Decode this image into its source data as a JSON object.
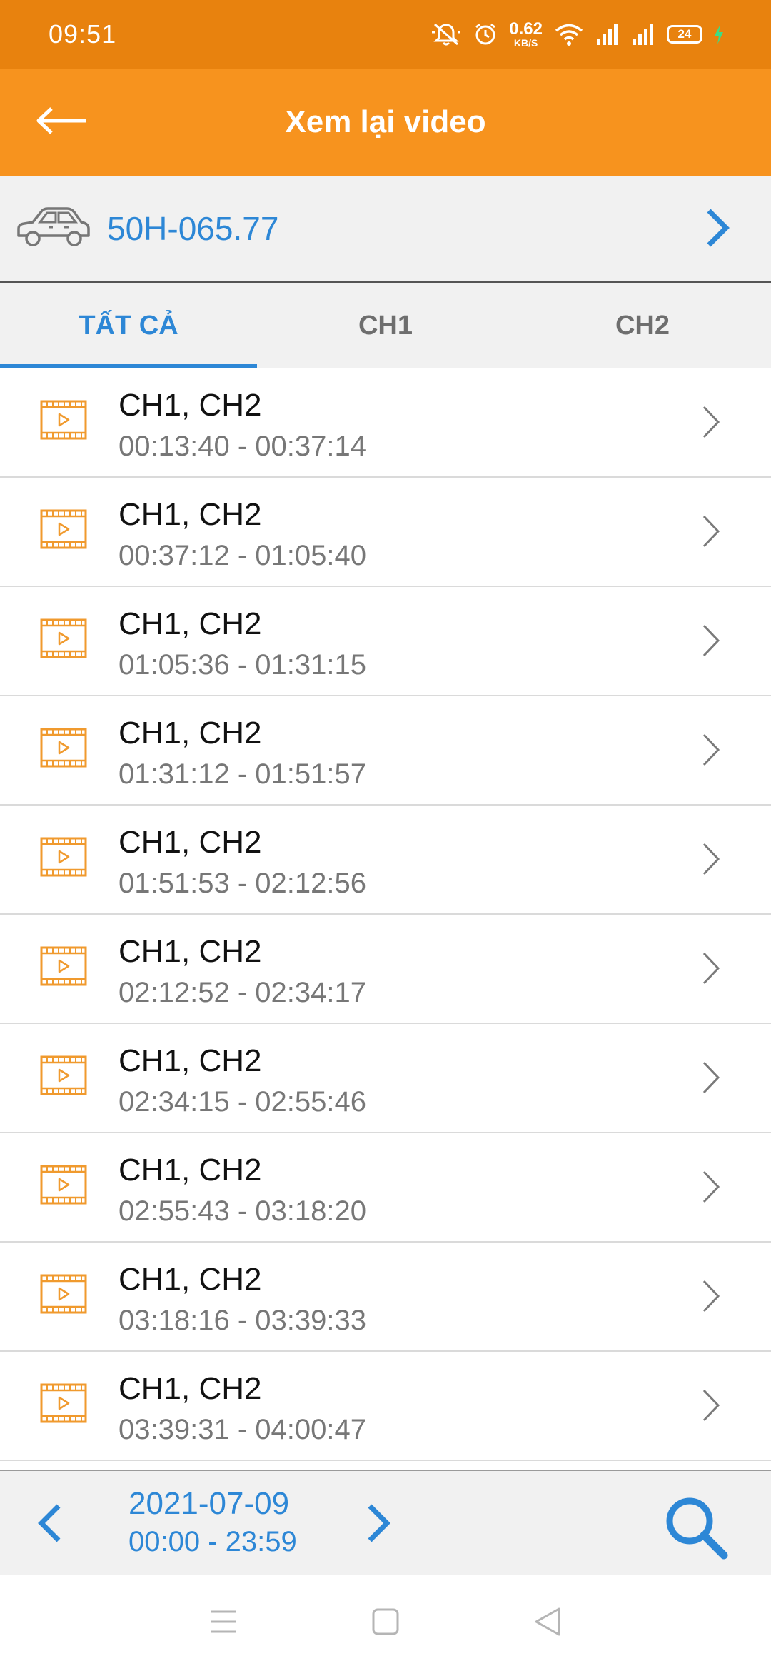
{
  "status": {
    "time": "09:51",
    "speed_value": "0.62",
    "speed_unit": "KB/S",
    "battery": "24"
  },
  "app_bar": {
    "title": "Xem lại video",
    "back_icon": "arrow-left-icon"
  },
  "vehicle": {
    "plate": "50H-065.77",
    "icon": "car-icon"
  },
  "tabs": [
    {
      "label": "TẤT CẢ",
      "active": true
    },
    {
      "label": "CH1",
      "active": false
    },
    {
      "label": "CH2",
      "active": false
    }
  ],
  "videos": [
    {
      "channels": "CH1, CH2",
      "range": "00:13:40 - 00:37:14"
    },
    {
      "channels": "CH1, CH2",
      "range": "00:37:12 - 01:05:40"
    },
    {
      "channels": "CH1, CH2",
      "range": "01:05:36 - 01:31:15"
    },
    {
      "channels": "CH1, CH2",
      "range": "01:31:12 - 01:51:57"
    },
    {
      "channels": "CH1, CH2",
      "range": "01:51:53 - 02:12:56"
    },
    {
      "channels": "CH1, CH2",
      "range": "02:12:52 - 02:34:17"
    },
    {
      "channels": "CH1, CH2",
      "range": "02:34:15 - 02:55:46"
    },
    {
      "channels": "CH1, CH2",
      "range": "02:55:43 - 03:18:20"
    },
    {
      "channels": "CH1, CH2",
      "range": "03:18:16 - 03:39:33"
    },
    {
      "channels": "CH1, CH2",
      "range": "03:39:31 - 04:00:47"
    }
  ],
  "date_bar": {
    "date": "2021-07-09",
    "range": "00:00 - 23:59"
  },
  "colors": {
    "status_bar": "#E8820E",
    "app_bar": "#F7931E",
    "accent_blue": "#2D87D6",
    "film_icon": "#F09A2E"
  }
}
